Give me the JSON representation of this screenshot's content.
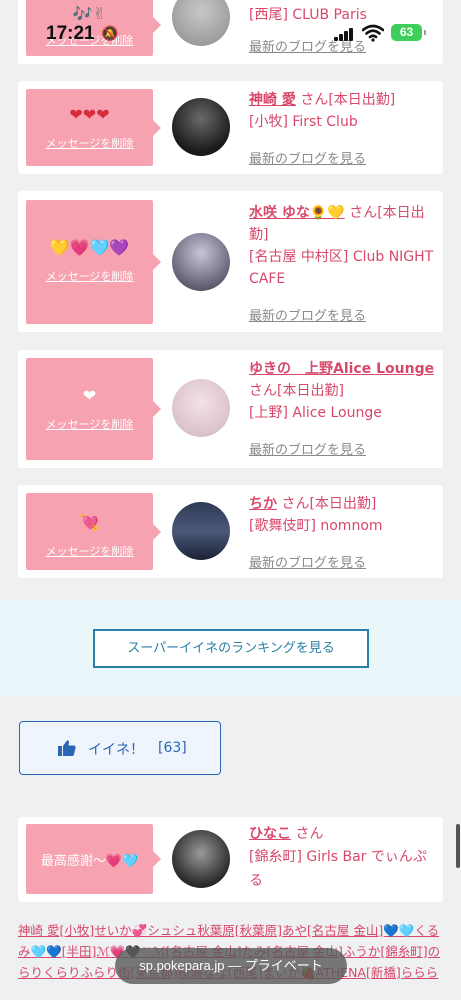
{
  "status": {
    "time": "17:21",
    "battery": "63"
  },
  "cards": [
    {
      "emoji": "🎶✌",
      "delete_label": "メッセージを削除",
      "name": "",
      "san": "",
      "status": "",
      "shop": "[西尾] CLUB Paris",
      "blog_link": "最新のブログを見る"
    },
    {
      "emoji": "❤❤❤",
      "delete_label": "メッセージを削除",
      "name": "神崎 愛",
      "san": "さん",
      "status": "[本日出勤]",
      "shop": "[小牧] First Club",
      "blog_link": "最新のブログを見る"
    },
    {
      "emoji": "💛💗🩵💜",
      "delete_label": "メッセージを削除",
      "name": "水咲 ゆな🌻💛",
      "san": "さん",
      "status": "[本日出勤]",
      "shop": "[名古屋 中村区] Club NIGHT CAFE",
      "blog_link": "最新のブログを見る"
    },
    {
      "emoji": "❤",
      "delete_label": "メッセージを削除",
      "name": "ゆきの　上野Alice Lounge",
      "san": "さん",
      "status": "[本日出勤]",
      "shop": "[上野] Alice Lounge",
      "blog_link": "最新のブログを見る"
    },
    {
      "emoji": "💘",
      "delete_label": "メッセージを削除",
      "name": "ちか",
      "san": "さん",
      "status": "[本日出勤]",
      "shop": "[歌舞伎町] nomnom",
      "blog_link": "最新のブログを見る"
    }
  ],
  "ranking_button": "スーパーイイネのランキングを見る",
  "like_button": {
    "label": "イイネ！",
    "count": "[63]"
  },
  "liked_card": {
    "message": "最高感謝〜💗🩵",
    "name": "ひなこ",
    "san": "さん",
    "shop": "[錦糸町] Girls Bar でぃんぷる"
  },
  "footer_text": "神崎 愛[小牧]せいか💞シュシュ秋葉原[秋葉原]あや[名古屋 金山]💙🩵くるみ🩵💙[半田]ℳ💗🖤♡ℳ[名古屋 金山]たみ[名古屋 金山]ふうか[錦糸町]のらりくらりふらり街[東京都]桜瀬なな[西尾]まいか🍓ATHENA[新橋]ららら",
  "browser": {
    "url_label": "sp.pokepara.jp — プライベート"
  }
}
